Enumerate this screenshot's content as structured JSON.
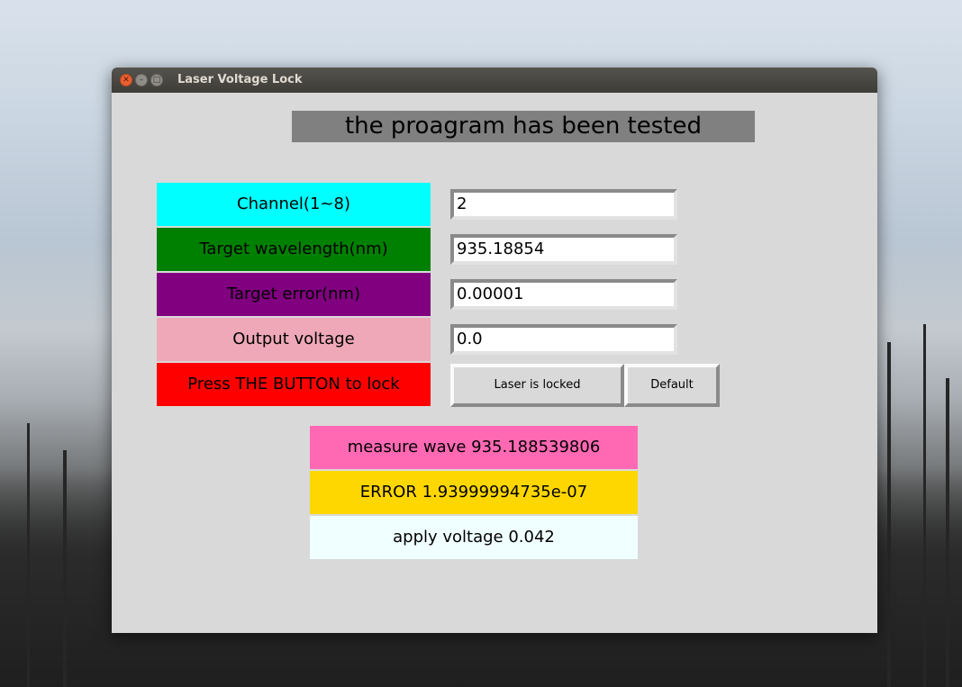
{
  "window": {
    "title": "Laser Voltage Lock"
  },
  "heading": "the proagram has been tested",
  "colors": {
    "channel": "#00ffff",
    "wavelength": "#008000",
    "error": "#800080",
    "voltage": "#eea8b8",
    "press": "#ff0000",
    "measure": "#ff69b4",
    "error_status": "#ffd700",
    "apply": "#f0ffff"
  },
  "form": {
    "channel_label": "Channel(1~8)",
    "channel_value": "2",
    "wavelength_label": "Target wavelength(nm)",
    "wavelength_value": "935.18854",
    "error_label": "Target error(nm)",
    "error_value": "0.00001",
    "voltage_label": "Output voltage",
    "voltage_value": "0.0",
    "press_label": "Press THE BUTTON to lock"
  },
  "buttons": {
    "lock": "Laser is locked",
    "default": "Default"
  },
  "status": {
    "measure": "measure wave 935.188539806",
    "error": "ERROR 1.93999994735e-07",
    "apply": "apply voltage 0.042"
  }
}
